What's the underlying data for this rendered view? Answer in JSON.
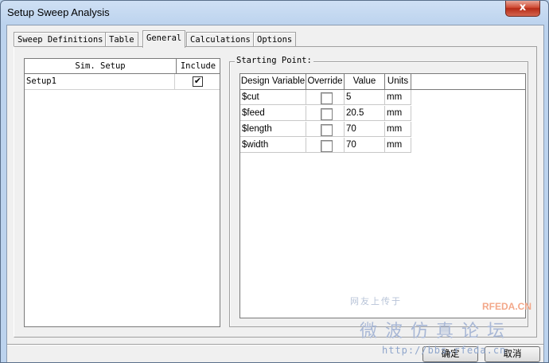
{
  "window": {
    "title": "Setup Sweep Analysis",
    "close_glyph": "x"
  },
  "tabs": [
    {
      "label": "Sweep Definitions"
    },
    {
      "label": "Table"
    },
    {
      "label": "General"
    },
    {
      "label": "Calculations"
    },
    {
      "label": "Options"
    }
  ],
  "active_tab": "General",
  "sim_table": {
    "headers": [
      "Sim. Setup",
      "Include"
    ],
    "rows": [
      {
        "name": "Setup1",
        "include": true,
        "check_glyph": "✔"
      }
    ]
  },
  "starting_point": {
    "label": "Starting Point:",
    "headers": [
      "Design Variable",
      "Override",
      "Value",
      "Units"
    ],
    "rows": [
      {
        "variable": "$cut",
        "override": false,
        "value": "5",
        "units": "mm"
      },
      {
        "variable": "$feed",
        "override": false,
        "value": "20.5",
        "units": "mm"
      },
      {
        "variable": "$length",
        "override": false,
        "value": "70",
        "units": "mm"
      },
      {
        "variable": "$width",
        "override": false,
        "value": "70",
        "units": "mm"
      }
    ]
  },
  "buttons": {
    "ok": "确定",
    "cancel": "取消"
  },
  "watermark": {
    "line1": "网友上传于",
    "brand": "RFEDA.CN",
    "line2": "微波仿真论坛",
    "url": "http://bbs.rfeda.cn"
  }
}
